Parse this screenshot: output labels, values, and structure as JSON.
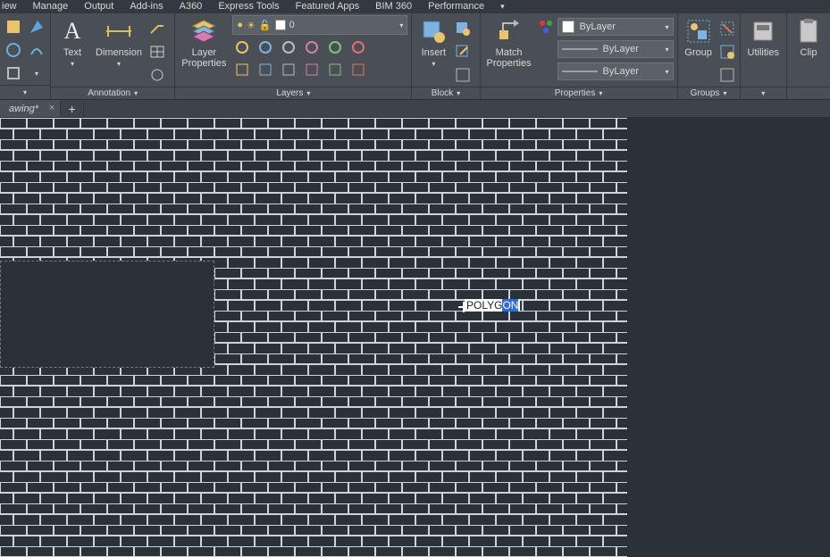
{
  "menubar": {
    "items": [
      "iew",
      "Manage",
      "Output",
      "Add-ins",
      "A360",
      "Express Tools",
      "Featured Apps",
      "BIM 360",
      "Performance"
    ]
  },
  "ribbon": {
    "annotation": {
      "title": "Annotation",
      "text_btn": "Text",
      "dimension_btn": "Dimension"
    },
    "layers": {
      "title": "Layers",
      "layerprops_btn": "Layer\nProperties",
      "current_layer": "0"
    },
    "block": {
      "title": "Block",
      "insert_btn": "Insert"
    },
    "properties": {
      "title": "Properties",
      "match_btn": "Match\nProperties",
      "color": "ByLayer",
      "ltype": "ByLayer",
      "lweight": "ByLayer"
    },
    "groups": {
      "title": "Groups",
      "group_btn": "Group"
    },
    "utilities": {
      "title": "",
      "utilities_btn": "Utilities"
    },
    "clipboard": {
      "clip_btn": "Clip"
    }
  },
  "tabs": {
    "active": "awing*",
    "plus": "+"
  },
  "canvas": {
    "command_typed": "POLYG",
    "command_completion": "ON"
  }
}
